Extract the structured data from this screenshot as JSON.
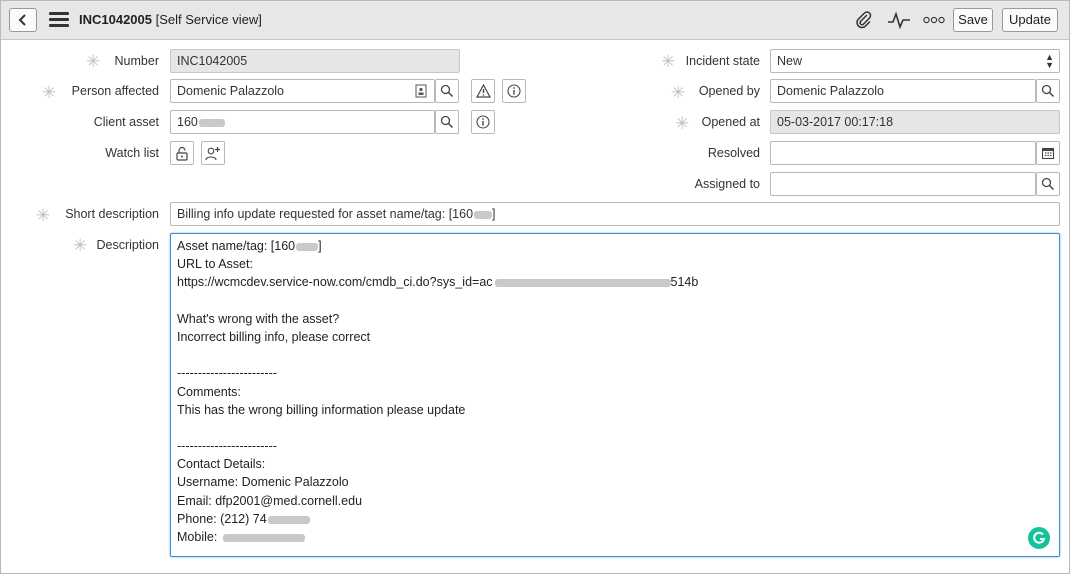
{
  "header": {
    "record_number": "INC1042005",
    "view_label": "[Self Service view]",
    "buttons": {
      "save": "Save",
      "update": "Update"
    }
  },
  "icons": {
    "back": "chevron-left-icon",
    "menu": "hamburger-icon",
    "attachment": "paperclip-icon",
    "activity": "pulse-icon",
    "more": "ellipsis-icon",
    "search": "magnifier-icon",
    "warning": "warning-triangle-icon",
    "info": "info-circle-icon",
    "calendar": "calendar-icon",
    "lock": "unlock-icon",
    "add_user": "add-user-icon",
    "grammarly": "grammarly-icon"
  },
  "colors": {
    "focus_border": "#3b8fd6",
    "grammarly": "#15c39a",
    "readonly_bg": "#e6e6e6"
  },
  "form": {
    "number": {
      "label": "Number",
      "value": "INC1042005"
    },
    "person_affected": {
      "label": "Person affected",
      "value": "Domenic Palazzolo"
    },
    "client_asset": {
      "label": "Client asset",
      "value": "160"
    },
    "watch_list": {
      "label": "Watch list"
    },
    "incident_state": {
      "label": "Incident state",
      "value": "New"
    },
    "opened_by": {
      "label": "Opened by",
      "value": "Domenic Palazzolo"
    },
    "opened_at": {
      "label": "Opened at",
      "value": "05-03-2017 00:17:18"
    },
    "resolved": {
      "label": "Resolved",
      "value": ""
    },
    "assigned_to": {
      "label": "Assigned to",
      "value": ""
    },
    "short_description": {
      "label": "Short description",
      "value": "Billing info update requested for asset name/tag: [160",
      "suffix": "]"
    },
    "description": {
      "label": "Description",
      "lines": {
        "l1a": "Asset name/tag: [160",
        "l1b": "]",
        "l2": "URL to Asset:",
        "l3a": "https://wcmcdev.service-now.com/cmdb_ci.do?sys_id=ac",
        "l3b": "514b",
        "l4": "",
        "l5": "What's wrong with the asset?",
        "l6": "Incorrect billing info, please correct",
        "l7": "",
        "l8": "------------------------",
        "l9": "Comments:",
        "l10": "This has the wrong billing information please update",
        "l11": "",
        "l12": "------------------------",
        "l13": "Contact Details:",
        "l14": "Username: Domenic Palazzolo",
        "l15": "Email: dfp2001@med.cornell.edu",
        "l16": "Phone: (212) 74",
        "l17": "Mobile:"
      }
    }
  }
}
